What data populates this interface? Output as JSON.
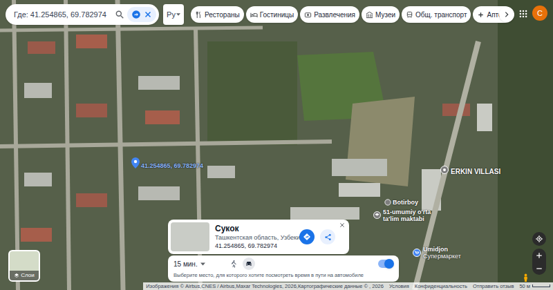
{
  "search": {
    "value": "Где: 41.254865, 69.782974"
  },
  "language": {
    "label": "Ру"
  },
  "chips": [
    {
      "label": "Рестораны"
    },
    {
      "label": "Гостиницы"
    },
    {
      "label": "Развлечения"
    },
    {
      "label": "Музеи"
    },
    {
      "label": "Общ. транспорт"
    },
    {
      "label": "Аптеки"
    }
  ],
  "account": {
    "initial": "C"
  },
  "pin": {
    "label": "41.254865, 69.782974"
  },
  "map_labels": [
    {
      "text": "ERKIN VILLASI"
    },
    {
      "text": "Botirboy"
    },
    {
      "text": "51-umumiy o'rta",
      "line2": "ta'lim maktabi"
    },
    {
      "text": "Umidjon",
      "line2": "Супермаркет"
    }
  ],
  "place_card": {
    "title": "Сукок",
    "subtitle": "Ташкентская область, Узбекистан",
    "coords": "41.254865, 69.782974"
  },
  "travel": {
    "time": "15 мин.",
    "modes": [
      {
        "kind": "walk",
        "selected": false
      },
      {
        "kind": "car",
        "selected": true
      }
    ],
    "hint": "Выберите место, для которого хотите посмотреть время в пути на автомобиле",
    "toggle_on": true
  },
  "layers": {
    "label": "Слои"
  },
  "footer": {
    "attribution": "Изображения © Airbus,CNES / Airbus,Maxar Technologies, 2026,Картографические данные © , 2026",
    "links": [
      "Условия",
      "Конфиденциальность",
      "Отправить отзыв"
    ],
    "scale": "50 м"
  }
}
